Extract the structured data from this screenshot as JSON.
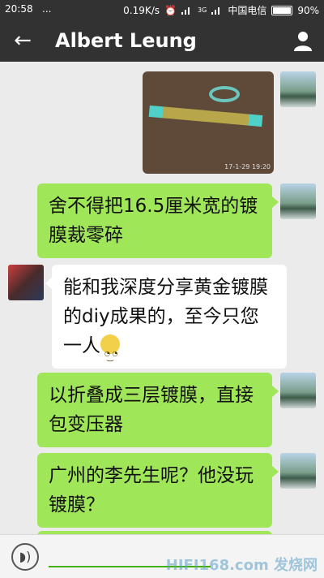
{
  "status_bar": {
    "time": "20:58",
    "dots": "...",
    "speed": "0.19K/s",
    "network": "3G",
    "carrier": "中国电信",
    "battery": "90%",
    "battery_level": 0.9
  },
  "header": {
    "back_icon": "back-arrow-icon",
    "title": "Albert Leung",
    "profile_icon": "person-icon"
  },
  "messages": {
    "m1": {
      "sender": "me",
      "type": "image",
      "stamp": "17-1-29 19:20"
    },
    "m2": {
      "sender": "me",
      "text": "舍不得把16.5厘米宽的镀膜裁零碎"
    },
    "m3": {
      "sender": "other",
      "text": "能和我深度分享黄金镀膜的diy成果的，至今只您一人"
    },
    "m4": {
      "sender": "me",
      "text": "以折叠成三层镀膜，直接包变压器"
    },
    "m5": {
      "sender": "me",
      "text": "广州的李先生呢？他没玩镀膜？"
    }
  },
  "input_bar": {
    "voice_icon": "voice-icon",
    "watermark": "HIFI168.com 发烧网"
  },
  "colors": {
    "bar": "#323232",
    "my_bubble": "#9fe658",
    "other_bubble": "#ffffff",
    "chat_bg": "#ebebeb"
  }
}
